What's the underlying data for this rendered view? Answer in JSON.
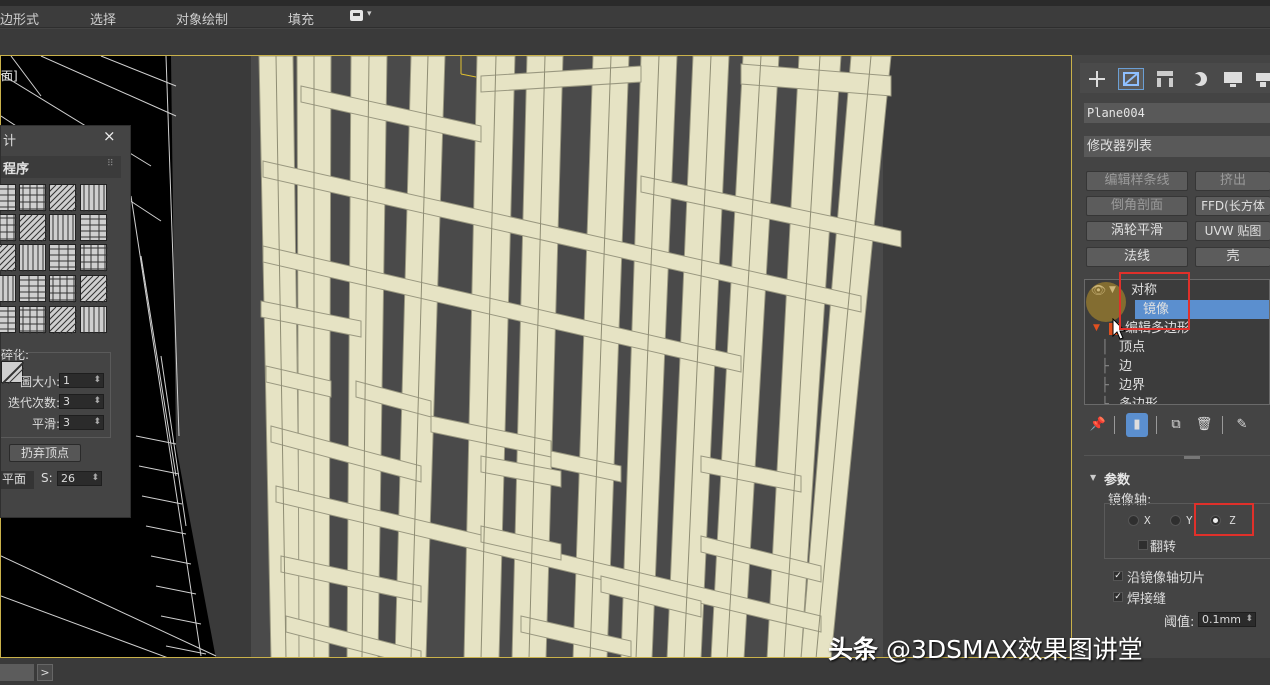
{
  "ribbon": {
    "tabs": [
      "边形式",
      "选择",
      "对象绘制",
      "填充"
    ]
  },
  "viewport": {
    "label": "面]"
  },
  "float_panel": {
    "title": "计",
    "close": "×",
    "header": "程序",
    "section_label": "碎化:",
    "rows": [
      {
        "label": "圖大小:",
        "value": "1"
      },
      {
        "label": "迭代次数:",
        "value": "3"
      },
      {
        "label": "平滑:",
        "value": "3"
      }
    ],
    "discard_button": "扔弃顶点",
    "bottom_label": "平面",
    "s_label": "S:",
    "s_value": "26"
  },
  "command_panel": {
    "object_name": "Plane004",
    "modifier_list": "修改器列表",
    "buttons": [
      {
        "label": "编辑样条线",
        "dim": true
      },
      {
        "label": "挤出",
        "dim": true
      },
      {
        "label": "倒角剖面",
        "dim": true
      },
      {
        "label": "FFD(长方体",
        "dim": false
      },
      {
        "label": "涡轮平滑",
        "dim": false
      },
      {
        "label": "UVW 贴图",
        "dim": false
      },
      {
        "label": "法线",
        "dim": false
      },
      {
        "label": "壳",
        "dim": false
      }
    ],
    "stack": {
      "symmetry": "对称",
      "mirror": "镜像",
      "edit_poly": "编辑多边形",
      "vertex": "顶点",
      "edge": "边",
      "border": "边界",
      "polygon": "多边形"
    },
    "rollout_title": "参数",
    "mirror_axis_label": "镜像轴:",
    "axes": [
      "X",
      "Y",
      "Z"
    ],
    "selected_axis": "Z",
    "flip_label": "翻转",
    "slice_label": "沿镜像轴切片",
    "weld_label": "焊接缝",
    "threshold_label": "阈值:",
    "threshold_value": "0.1mm"
  },
  "bottom": {
    "arrow": ">"
  },
  "watermark": {
    "brand": "头条",
    "handle": "@3DSMAX效果图讲堂"
  },
  "colors": {
    "highlight_red": "#e0302a",
    "selection_blue": "#5b8fcf",
    "viewport_border": "#c9b14a",
    "mesh": "#e6e3c4"
  }
}
